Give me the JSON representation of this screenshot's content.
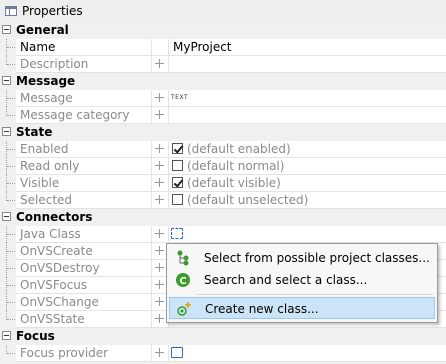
{
  "window": {
    "title": "Properties"
  },
  "categories": {
    "general": "General",
    "message": "Message",
    "state": "State",
    "connectors": "Connectors",
    "focus": "Focus"
  },
  "properties": {
    "name": {
      "label": "Name",
      "value": "MyProject"
    },
    "description": {
      "label": "Description"
    },
    "message": {
      "label": "Message",
      "value": "TEXT"
    },
    "message_category": {
      "label": "Message category"
    },
    "enabled": {
      "label": "Enabled",
      "value": "(default enabled)",
      "checked": true
    },
    "read_only": {
      "label": "Read only",
      "value": "(default normal)",
      "checked": false
    },
    "visible": {
      "label": "Visible",
      "value": "(default visible)",
      "checked": true
    },
    "selected": {
      "label": "Selected",
      "value": "(default unselected)",
      "checked": false
    },
    "java_class": {
      "label": "Java Class"
    },
    "onvscreate": {
      "label": "OnVSCreate"
    },
    "onvsdestroy": {
      "label": "OnVSDestroy"
    },
    "onvsfocus": {
      "label": "OnVSFocus"
    },
    "onvschange": {
      "label": "OnVSChange"
    },
    "onvsstate": {
      "label": "OnVSState"
    },
    "focus_provider": {
      "label": "Focus provider"
    }
  },
  "context_menu": {
    "items": [
      {
        "label": "Select from possible project classes...",
        "icon": "tree-classes-icon"
      },
      {
        "label": "Search and select a class...",
        "icon": "class-search-icon"
      },
      {
        "label": "Create new class...",
        "icon": "new-class-icon",
        "selected": true
      }
    ]
  },
  "colors": {
    "menu_highlight": "#cce4f7",
    "icon_green": "#3a9d2a",
    "button_blue": "#2c6ccc"
  }
}
